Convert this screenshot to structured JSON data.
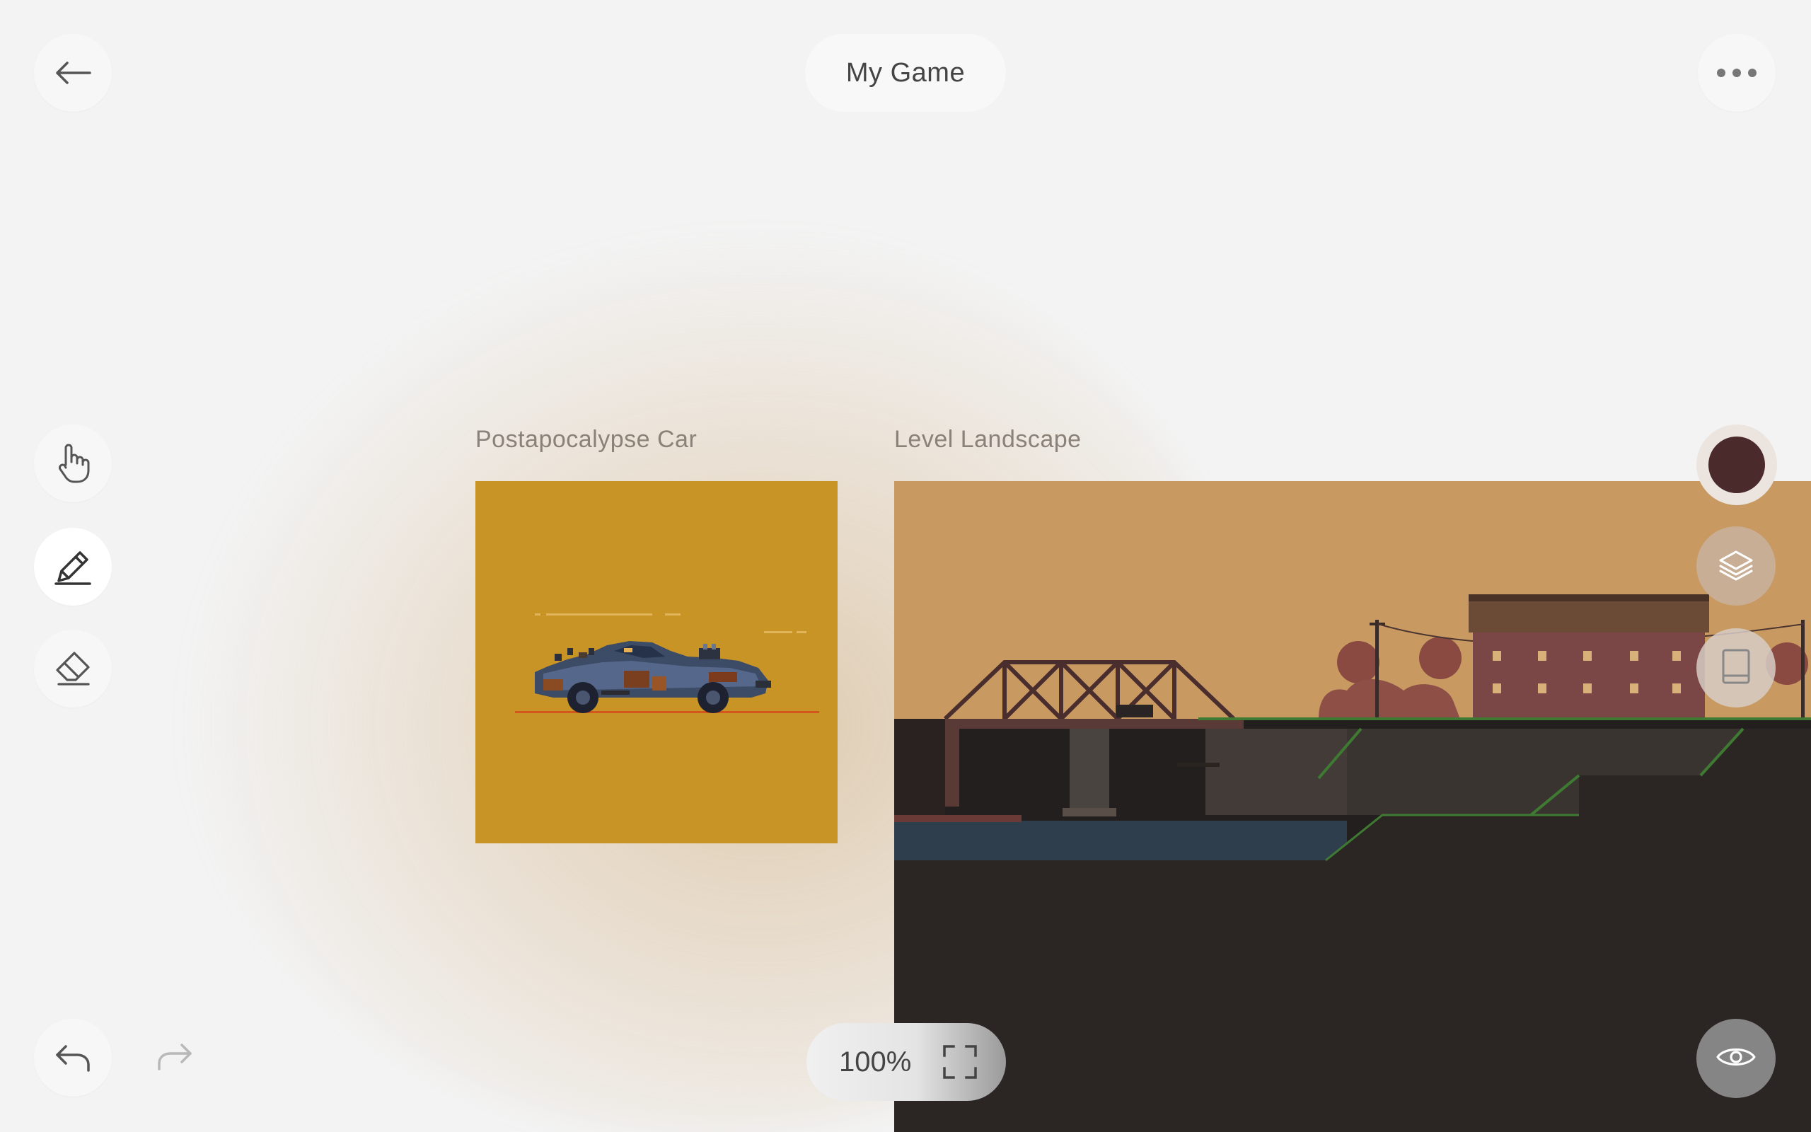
{
  "header": {
    "back_icon": "arrow-left-icon",
    "title": "My Game",
    "more_icon": "more-horizontal-icon"
  },
  "tools": {
    "items": [
      {
        "name": "hand-tool",
        "icon": "hand-icon",
        "active": false
      },
      {
        "name": "pen-tool",
        "icon": "pen-icon",
        "active": true
      },
      {
        "name": "eraser-tool",
        "icon": "eraser-icon",
        "active": false
      }
    ]
  },
  "artboards": [
    {
      "label": "Postapocalypse Car",
      "background": "#c99426"
    },
    {
      "label": "Level Landscape",
      "background": "#c89a62"
    }
  ],
  "right_panel": {
    "color_swatch": "#4a2a2a",
    "layers_icon": "layers-icon",
    "library_icon": "book-icon",
    "preview_icon": "eye-icon"
  },
  "footer": {
    "undo_icon": "undo-icon",
    "redo_icon": "redo-icon",
    "zoom": "100%",
    "fit_icon": "fit-screen-icon"
  }
}
